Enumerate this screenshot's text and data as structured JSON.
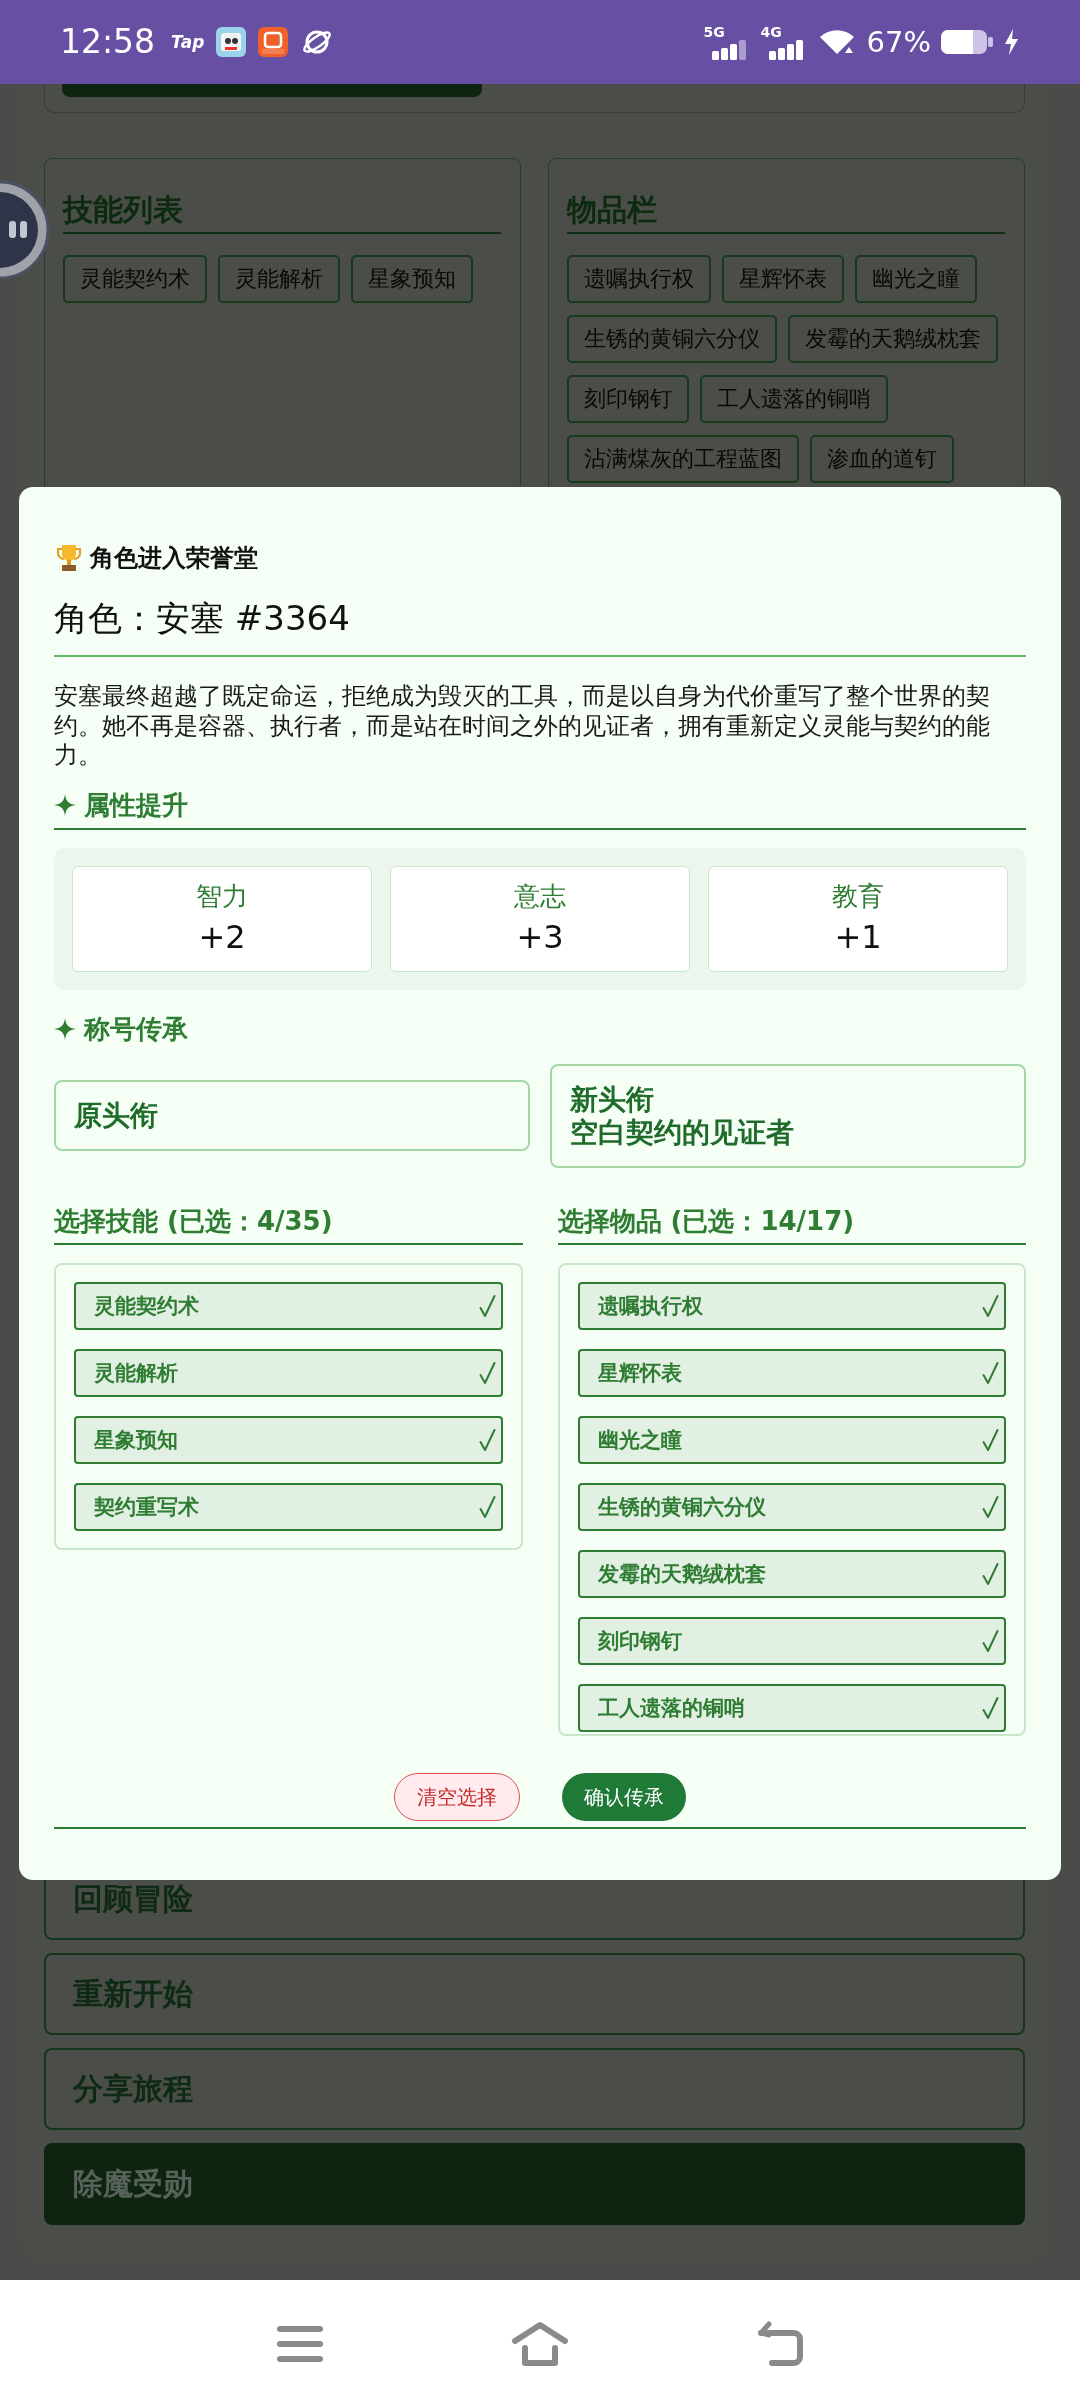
{
  "status_bar": {
    "time": "12:58",
    "app_logo": "Tap",
    "networks": [
      "5G",
      "4G"
    ],
    "battery": "67%"
  },
  "page": {
    "skills_panel": {
      "title": "技能列表",
      "tags": [
        "灵能契约术",
        "灵能解析",
        "星象预知"
      ]
    },
    "items_panel": {
      "title": "物品栏",
      "tags": [
        "遗嘱执行权",
        "星辉怀表",
        "幽光之瞳",
        "生锈的黄铜六分仪",
        "发霉的天鹅绒枕套",
        "刻印钢钉",
        "工人遗落的铜哨",
        "沾满煤灰的工程蓝图",
        "渗血的道钉"
      ]
    },
    "menu": [
      {
        "label": "回顾冒险",
        "primary": false
      },
      {
        "label": "重新开始",
        "primary": false
      },
      {
        "label": "分享旅程",
        "primary": false
      },
      {
        "label": "除魔受勋",
        "primary": true
      }
    ]
  },
  "dialog": {
    "title": "角色进入荣誉堂",
    "character": "角色：安塞 #3364",
    "description": "安塞最终超越了既定命运，拒绝成为毁灭的工具，而是以自身为代价重写了整个世界的契约。她不再是容器、执行者，而是站在时间之外的见证者，拥有重新定义灵能与契约的能力。",
    "attributes": {
      "heading": "属性提升",
      "stats": [
        {
          "name": "智力",
          "value": "+2"
        },
        {
          "name": "意志",
          "value": "+3"
        },
        {
          "name": "教育",
          "value": "+1"
        }
      ]
    },
    "titles": {
      "heading": "称号传承",
      "cards": [
        {
          "label": "原头衔"
        },
        {
          "label": "新头衔",
          "value": "空白契约的见证者"
        }
      ]
    },
    "skills": {
      "heading": "选择技能 (已选：4/35)",
      "items": [
        {
          "label": "灵能契约术",
          "selected": true
        },
        {
          "label": "灵能解析",
          "selected": true
        },
        {
          "label": "星象预知",
          "selected": true
        },
        {
          "label": "契约重写术",
          "selected": true
        }
      ]
    },
    "items": {
      "heading": "选择物品 (已选：14/17)",
      "items": [
        {
          "label": "遗嘱执行权",
          "selected": true
        },
        {
          "label": "星辉怀表",
          "selected": true
        },
        {
          "label": "幽光之瞳",
          "selected": true
        },
        {
          "label": "生锈的黄铜六分仪",
          "selected": true
        },
        {
          "label": "发霉的天鹅绒枕套",
          "selected": true
        },
        {
          "label": "刻印钢钉",
          "selected": true
        },
        {
          "label": "工人遗落的铜哨",
          "selected": true
        }
      ]
    },
    "buttons": [
      {
        "label": "清空选择",
        "kind": "clear"
      },
      {
        "label": "确认传承",
        "kind": "confirm"
      }
    ]
  }
}
